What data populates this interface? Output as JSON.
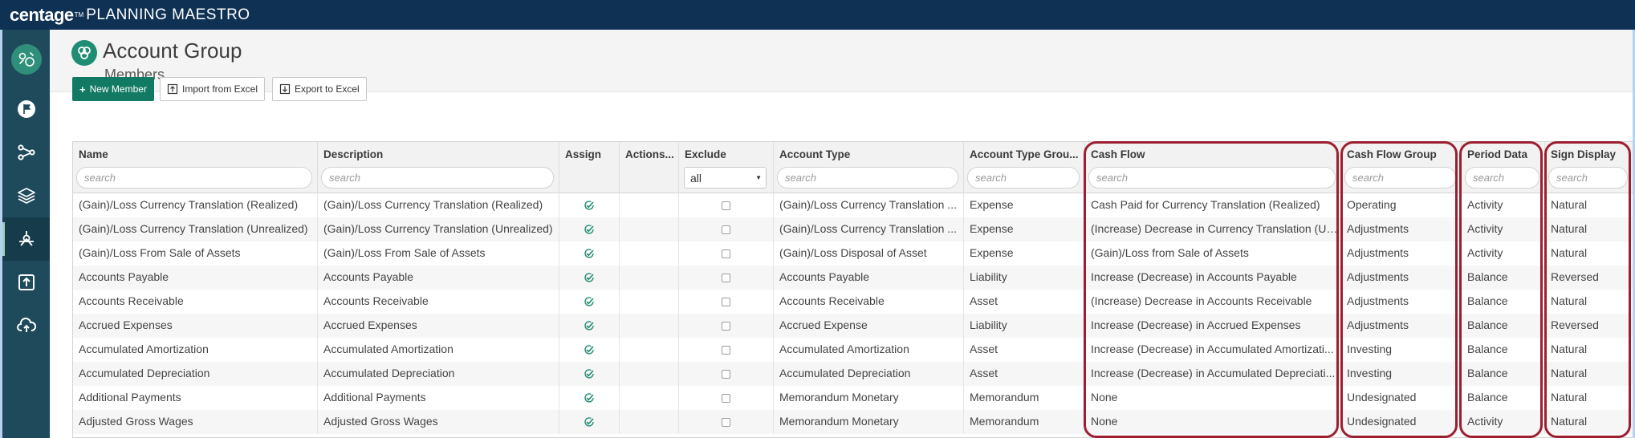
{
  "brand": {
    "logo": "centage",
    "product": "PLANNING MAESTRO",
    "tm": "TM"
  },
  "sidebar": {
    "items": [
      "home-logo",
      "flag",
      "workflow",
      "layers",
      "model",
      "upload",
      "cloud-upload"
    ]
  },
  "header": {
    "title": "Account Group",
    "subtitle": "Members"
  },
  "toolbar": {
    "new_member": "New Member",
    "import": "Import from Excel",
    "export": "Export to Excel"
  },
  "columns": [
    {
      "key": "name",
      "label": "Name",
      "filter": "search"
    },
    {
      "key": "desc",
      "label": "Description",
      "filter": "search"
    },
    {
      "key": "assign",
      "label": "Assign",
      "filter": ""
    },
    {
      "key": "actions",
      "label": "Actions...",
      "filter": ""
    },
    {
      "key": "exclude",
      "label": "Exclude",
      "filter": "all"
    },
    {
      "key": "acct_type",
      "label": "Account Type",
      "filter": "search"
    },
    {
      "key": "acct_type_group",
      "label": "Account Type Grou...",
      "filter": "search"
    },
    {
      "key": "cash_flow",
      "label": "Cash Flow",
      "filter": "search"
    },
    {
      "key": "cash_flow_group",
      "label": "Cash Flow Group",
      "filter": "search"
    },
    {
      "key": "period_data",
      "label": "Period Data",
      "filter": "search"
    },
    {
      "key": "sign_display",
      "label": "Sign Display",
      "filter": "search"
    }
  ],
  "rows": [
    {
      "name": "(Gain)/Loss Currency Translation (Realized)",
      "desc": "(Gain)/Loss Currency Translation (Realized)",
      "acct_type": "(Gain)/Loss Currency Translation ...",
      "acct_type_group": "Expense",
      "cash_flow": "Cash Paid for Currency Translation (Realized)",
      "cash_flow_group": "Operating",
      "period_data": "Activity",
      "sign_display": "Natural"
    },
    {
      "name": "(Gain)/Loss Currency Translation (Unrealized)",
      "desc": "(Gain)/Loss Currency Translation (Unrealized)",
      "acct_type": "(Gain)/Loss Currency Translation ...",
      "acct_type_group": "Expense",
      "cash_flow": "(Increase) Decrease in Currency Translation (Un...",
      "cash_flow_group": "Adjustments",
      "period_data": "Activity",
      "sign_display": "Natural"
    },
    {
      "name": "(Gain)/Loss From Sale of Assets",
      "desc": "(Gain)/Loss From Sale of Assets",
      "acct_type": "(Gain)/Loss Disposal of Asset",
      "acct_type_group": "Expense",
      "cash_flow": "(Gain)/Loss from Sale of Assets",
      "cash_flow_group": "Adjustments",
      "period_data": "Activity",
      "sign_display": "Natural"
    },
    {
      "name": "Accounts Payable",
      "desc": "Accounts Payable",
      "acct_type": "Accounts Payable",
      "acct_type_group": "Liability",
      "cash_flow": "Increase (Decrease) in Accounts Payable",
      "cash_flow_group": "Adjustments",
      "period_data": "Balance",
      "sign_display": "Reversed"
    },
    {
      "name": "Accounts Receivable",
      "desc": "Accounts Receivable",
      "acct_type": "Accounts Receivable",
      "acct_type_group": "Asset",
      "cash_flow": "(Increase) Decrease in Accounts Receivable",
      "cash_flow_group": "Adjustments",
      "period_data": "Balance",
      "sign_display": "Natural"
    },
    {
      "name": "Accrued Expenses",
      "desc": "Accrued Expenses",
      "acct_type": "Accrued Expense",
      "acct_type_group": "Liability",
      "cash_flow": "Increase (Decrease) in Accrued Expenses",
      "cash_flow_group": "Adjustments",
      "period_data": "Balance",
      "sign_display": "Reversed"
    },
    {
      "name": "Accumulated Amortization",
      "desc": "Accumulated Amortization",
      "acct_type": "Accumulated Amortization",
      "acct_type_group": "Asset",
      "cash_flow": "Increase (Decrease) in Accumulated Amortizati...",
      "cash_flow_group": "Investing",
      "period_data": "Balance",
      "sign_display": "Natural"
    },
    {
      "name": "Accumulated Depreciation",
      "desc": "Accumulated Depreciation",
      "acct_type": "Accumulated Depreciation",
      "acct_type_group": "Asset",
      "cash_flow": "Increase (Decrease) in Accumulated Depreciati...",
      "cash_flow_group": "Investing",
      "period_data": "Balance",
      "sign_display": "Natural"
    },
    {
      "name": "Additional Payments",
      "desc": "Additional Payments",
      "acct_type": "Memorandum Monetary",
      "acct_type_group": "Memorandum",
      "cash_flow": "None",
      "cash_flow_group": "Undesignated",
      "period_data": "Balance",
      "sign_display": "Natural"
    },
    {
      "name": "Adjusted Gross Wages",
      "desc": "Adjusted Gross Wages",
      "acct_type": "Memorandum Monetary",
      "acct_type_group": "Memorandum",
      "cash_flow": "None",
      "cash_flow_group": "Undesignated",
      "period_data": "Activity",
      "sign_display": "Natural"
    }
  ],
  "colors": {
    "topbar": "#0f3153",
    "sidebar": "#1e4a5c",
    "accent": "#127a63",
    "highlight": "#9b1f2e",
    "check": "#1f8c74"
  }
}
